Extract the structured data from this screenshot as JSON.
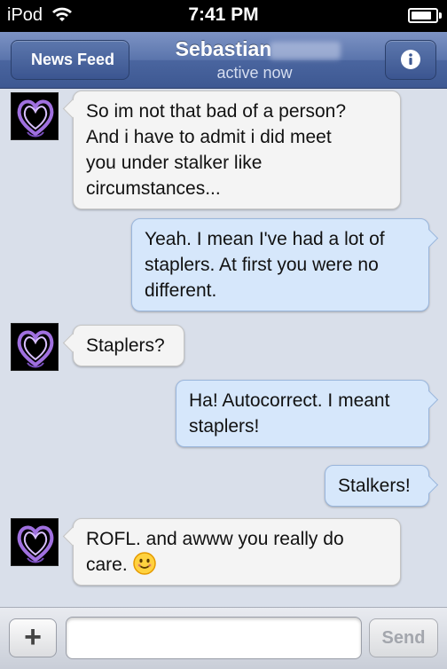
{
  "status_bar": {
    "carrier": "iPod",
    "time": "7:41 PM",
    "battery": 0.85
  },
  "nav": {
    "back_label": "News Feed",
    "title": "Sebastian",
    "subtitle": "active now",
    "info_icon": "info-icon"
  },
  "messages": [
    {
      "direction": "incoming",
      "lines": [
        "So im not that bad of a person?",
        "And i have to admit i did meet",
        "you under stalker like",
        "circumstances..."
      ]
    },
    {
      "direction": "outgoing",
      "lines": [
        "Yeah. I mean I've had a lot of",
        "staplers. At first you were no",
        "different."
      ]
    },
    {
      "direction": "incoming",
      "lines": [
        "Staplers?"
      ]
    },
    {
      "direction": "outgoing",
      "lines": [
        "Ha! Autocorrect. I meant",
        "staplers!"
      ]
    },
    {
      "direction": "outgoing",
      "lines": [
        "Stalkers!"
      ]
    },
    {
      "direction": "incoming",
      "lines": [
        "ROFL. and awww you really do",
        "care."
      ],
      "emoji": "smiley-icon"
    }
  ],
  "input": {
    "add_label": "+",
    "value": "",
    "send_label": "Send"
  },
  "colors": {
    "nav": "#4a659f",
    "incoming_bubble": "#f4f4f4",
    "outgoing_bubble": "#d6e7fb",
    "background": "#d9dfea"
  }
}
